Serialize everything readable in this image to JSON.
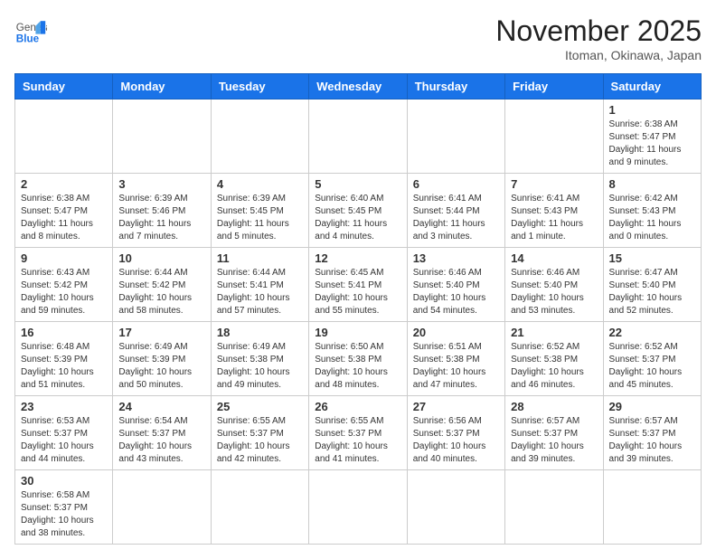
{
  "header": {
    "logo_general": "General",
    "logo_blue": "Blue",
    "month_title": "November 2025",
    "location": "Itoman, Okinawa, Japan"
  },
  "weekdays": [
    "Sunday",
    "Monday",
    "Tuesday",
    "Wednesday",
    "Thursday",
    "Friday",
    "Saturday"
  ],
  "weeks": [
    [
      {
        "day": "",
        "info": ""
      },
      {
        "day": "",
        "info": ""
      },
      {
        "day": "",
        "info": ""
      },
      {
        "day": "",
        "info": ""
      },
      {
        "day": "",
        "info": ""
      },
      {
        "day": "",
        "info": ""
      },
      {
        "day": "1",
        "info": "Sunrise: 6:38 AM\nSunset: 5:47 PM\nDaylight: 11 hours\nand 9 minutes."
      }
    ],
    [
      {
        "day": "2",
        "info": "Sunrise: 6:38 AM\nSunset: 5:47 PM\nDaylight: 11 hours\nand 8 minutes."
      },
      {
        "day": "3",
        "info": "Sunrise: 6:39 AM\nSunset: 5:46 PM\nDaylight: 11 hours\nand 7 minutes."
      },
      {
        "day": "4",
        "info": "Sunrise: 6:39 AM\nSunset: 5:45 PM\nDaylight: 11 hours\nand 5 minutes."
      },
      {
        "day": "5",
        "info": "Sunrise: 6:40 AM\nSunset: 5:45 PM\nDaylight: 11 hours\nand 4 minutes."
      },
      {
        "day": "6",
        "info": "Sunrise: 6:41 AM\nSunset: 5:44 PM\nDaylight: 11 hours\nand 3 minutes."
      },
      {
        "day": "7",
        "info": "Sunrise: 6:41 AM\nSunset: 5:43 PM\nDaylight: 11 hours\nand 1 minute."
      },
      {
        "day": "8",
        "info": "Sunrise: 6:42 AM\nSunset: 5:43 PM\nDaylight: 11 hours\nand 0 minutes."
      }
    ],
    [
      {
        "day": "9",
        "info": "Sunrise: 6:43 AM\nSunset: 5:42 PM\nDaylight: 10 hours\nand 59 minutes."
      },
      {
        "day": "10",
        "info": "Sunrise: 6:44 AM\nSunset: 5:42 PM\nDaylight: 10 hours\nand 58 minutes."
      },
      {
        "day": "11",
        "info": "Sunrise: 6:44 AM\nSunset: 5:41 PM\nDaylight: 10 hours\nand 57 minutes."
      },
      {
        "day": "12",
        "info": "Sunrise: 6:45 AM\nSunset: 5:41 PM\nDaylight: 10 hours\nand 55 minutes."
      },
      {
        "day": "13",
        "info": "Sunrise: 6:46 AM\nSunset: 5:40 PM\nDaylight: 10 hours\nand 54 minutes."
      },
      {
        "day": "14",
        "info": "Sunrise: 6:46 AM\nSunset: 5:40 PM\nDaylight: 10 hours\nand 53 minutes."
      },
      {
        "day": "15",
        "info": "Sunrise: 6:47 AM\nSunset: 5:40 PM\nDaylight: 10 hours\nand 52 minutes."
      }
    ],
    [
      {
        "day": "16",
        "info": "Sunrise: 6:48 AM\nSunset: 5:39 PM\nDaylight: 10 hours\nand 51 minutes."
      },
      {
        "day": "17",
        "info": "Sunrise: 6:49 AM\nSunset: 5:39 PM\nDaylight: 10 hours\nand 50 minutes."
      },
      {
        "day": "18",
        "info": "Sunrise: 6:49 AM\nSunset: 5:38 PM\nDaylight: 10 hours\nand 49 minutes."
      },
      {
        "day": "19",
        "info": "Sunrise: 6:50 AM\nSunset: 5:38 PM\nDaylight: 10 hours\nand 48 minutes."
      },
      {
        "day": "20",
        "info": "Sunrise: 6:51 AM\nSunset: 5:38 PM\nDaylight: 10 hours\nand 47 minutes."
      },
      {
        "day": "21",
        "info": "Sunrise: 6:52 AM\nSunset: 5:38 PM\nDaylight: 10 hours\nand 46 minutes."
      },
      {
        "day": "22",
        "info": "Sunrise: 6:52 AM\nSunset: 5:37 PM\nDaylight: 10 hours\nand 45 minutes."
      }
    ],
    [
      {
        "day": "23",
        "info": "Sunrise: 6:53 AM\nSunset: 5:37 PM\nDaylight: 10 hours\nand 44 minutes."
      },
      {
        "day": "24",
        "info": "Sunrise: 6:54 AM\nSunset: 5:37 PM\nDaylight: 10 hours\nand 43 minutes."
      },
      {
        "day": "25",
        "info": "Sunrise: 6:55 AM\nSunset: 5:37 PM\nDaylight: 10 hours\nand 42 minutes."
      },
      {
        "day": "26",
        "info": "Sunrise: 6:55 AM\nSunset: 5:37 PM\nDaylight: 10 hours\nand 41 minutes."
      },
      {
        "day": "27",
        "info": "Sunrise: 6:56 AM\nSunset: 5:37 PM\nDaylight: 10 hours\nand 40 minutes."
      },
      {
        "day": "28",
        "info": "Sunrise: 6:57 AM\nSunset: 5:37 PM\nDaylight: 10 hours\nand 39 minutes."
      },
      {
        "day": "29",
        "info": "Sunrise: 6:57 AM\nSunset: 5:37 PM\nDaylight: 10 hours\nand 39 minutes."
      }
    ],
    [
      {
        "day": "30",
        "info": "Sunrise: 6:58 AM\nSunset: 5:37 PM\nDaylight: 10 hours\nand 38 minutes."
      },
      {
        "day": "",
        "info": ""
      },
      {
        "day": "",
        "info": ""
      },
      {
        "day": "",
        "info": ""
      },
      {
        "day": "",
        "info": ""
      },
      {
        "day": "",
        "info": ""
      },
      {
        "day": "",
        "info": ""
      }
    ]
  ]
}
